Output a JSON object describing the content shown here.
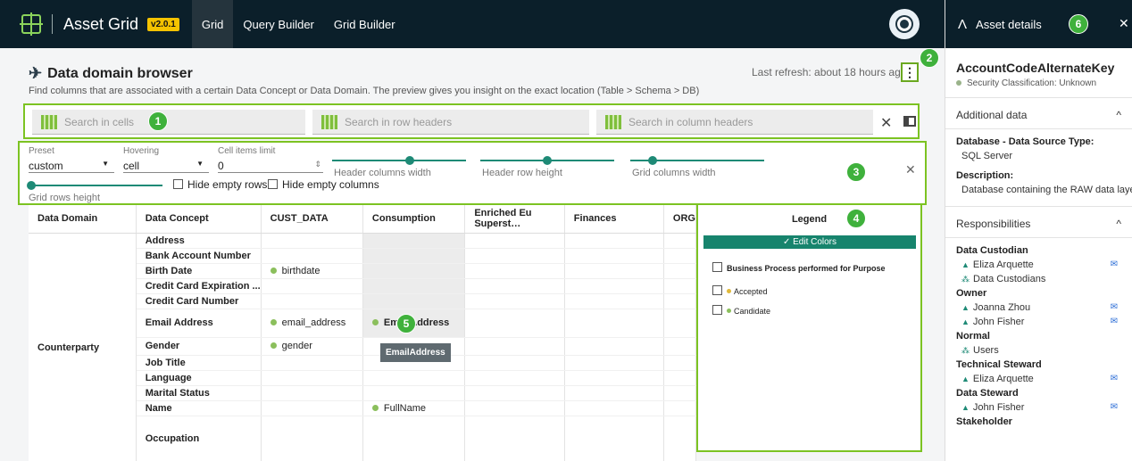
{
  "topbar": {
    "app_name": "Asset Grid",
    "version": "v2.0.1",
    "nav": [
      "Grid",
      "Query Builder",
      "Grid Builder"
    ]
  },
  "page": {
    "title": "Data domain browser",
    "subtitle": "Find columns that are associated with a certain Data Concept or Data Domain. The preview gives you insight on the exact location (Table > Schema > DB)",
    "refresh": "Last refresh: about 18 hours ago"
  },
  "search": {
    "cells_placeholder": "Search in cells",
    "row_headers_placeholder": "Search in row headers",
    "column_headers_placeholder": "Search in column headers"
  },
  "controls": {
    "preset_label": "Preset",
    "preset_value": "custom",
    "hovering_label": "Hovering",
    "hovering_value": "cell",
    "limit_label": "Cell items limit",
    "limit_value": "0",
    "header_columns_width": "Header columns width",
    "header_row_height": "Header row height",
    "grid_columns_width": "Grid columns width",
    "grid_rows_height": "Grid rows height",
    "hide_empty_rows": "Hide empty rows",
    "hide_empty_columns": "Hide empty columns"
  },
  "table": {
    "headers": [
      "Data Domain",
      "Data Concept",
      "CUST_DATA",
      "Consumption",
      "Enriched Eu Superst…",
      "Finances",
      "ORG"
    ],
    "domain": "Counterparty",
    "rows": [
      {
        "concept": "Address",
        "cust": "",
        "cons": ""
      },
      {
        "concept": "Bank Account Number",
        "cust": "",
        "cons": ""
      },
      {
        "concept": "Birth Date",
        "cust": "birthdate",
        "cons": ""
      },
      {
        "concept": "Credit Card Expiration ...",
        "cust": "",
        "cons": ""
      },
      {
        "concept": "Credit Card Number",
        "cust": "",
        "cons": ""
      },
      {
        "concept": "Email Address",
        "cust": "email_address",
        "cons": "EmailAddress"
      },
      {
        "concept": "Gender",
        "cust": "gender",
        "cons": ""
      },
      {
        "concept": "Job Title",
        "cust": "",
        "cons": ""
      },
      {
        "concept": "Language",
        "cust": "",
        "cons": ""
      },
      {
        "concept": "Marital Status",
        "cust": "",
        "cons": ""
      },
      {
        "concept": "Name",
        "cust": "",
        "cons": "FullName"
      },
      {
        "concept": "Occupation",
        "cust": "",
        "cons": ""
      }
    ],
    "tooltip": "EmailAddress"
  },
  "legend": {
    "title": "Legend",
    "edit_colors": "✓ Edit Colors",
    "heading": "Business Process performed for Purpose",
    "items": [
      {
        "label": "Accepted",
        "color": "#e0b93a"
      },
      {
        "label": "Candidate",
        "color": "#8bbf5c"
      }
    ]
  },
  "badges": [
    "1",
    "2",
    "3",
    "4",
    "5",
    "6"
  ],
  "panel": {
    "header": "Asset details",
    "asset_name": "AccountCodeAlternateKey",
    "security": "Security Classification: Unknown",
    "additional_data": "Additional data",
    "db_type_label": "Database - Data Source Type:",
    "db_type_value": "SQL Server",
    "description_label": "Description:",
    "description_value": "Database containing the RAW data layer",
    "responsibilities": "Responsibilities",
    "data_custodian": "Data Custodian",
    "eliza": "Eliza Arquette",
    "data_custodians": "Data Custodians",
    "owner": "Owner",
    "joanna": "Joanna Zhou",
    "john": "John Fisher",
    "normal": "Normal",
    "users": "Users",
    "technical_steward": "Technical Steward",
    "data_steward": "Data Steward",
    "stakeholder": "Stakeholder"
  }
}
